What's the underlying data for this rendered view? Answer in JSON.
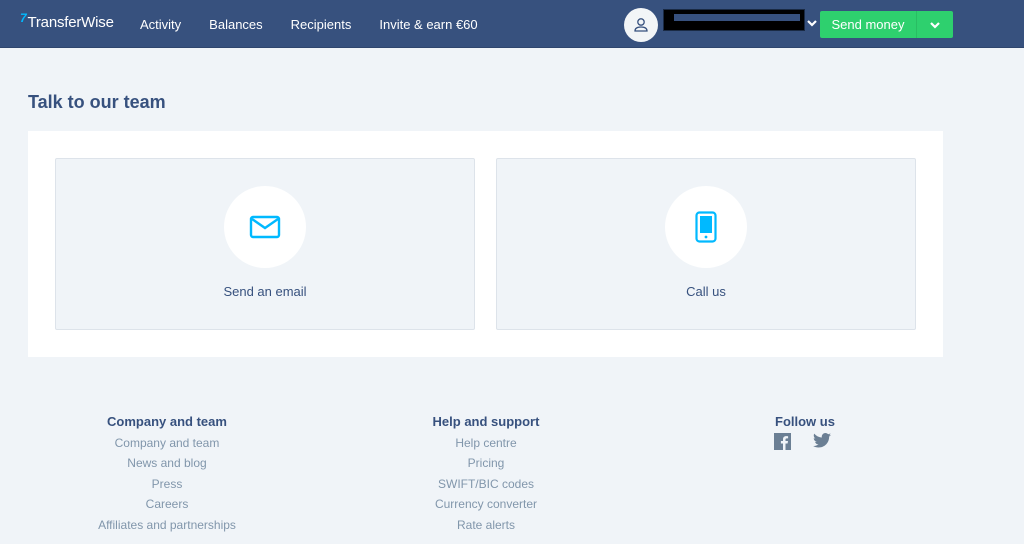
{
  "header": {
    "logo_mark": "7",
    "logo_text": "TransferWise",
    "nav": [
      {
        "label": "Activity"
      },
      {
        "label": "Balances"
      },
      {
        "label": "Recipients"
      },
      {
        "label": "Invite & earn €60"
      }
    ],
    "user_icon": "user-icon",
    "user_name_redacted": true,
    "send_money_label": "Send money",
    "colors": {
      "bar": "#37517e",
      "accent": "#2ed06e",
      "icon_blue": "#00b9ff"
    }
  },
  "main": {
    "title": "Talk to our team",
    "cards": [
      {
        "label": "Send an email",
        "icon": "envelope-icon"
      },
      {
        "label": "Call us",
        "icon": "phone-icon"
      }
    ]
  },
  "footer": {
    "columns": [
      {
        "heading": "Company and team",
        "links": [
          "Company and team",
          "News and blog",
          "Press",
          "Careers",
          "Affiliates and partnerships"
        ]
      },
      {
        "heading": "Help and support",
        "links": [
          "Help centre",
          "Pricing",
          "SWIFT/BIC codes",
          "Currency converter",
          "Rate alerts"
        ]
      }
    ],
    "follow": {
      "heading": "Follow us",
      "icons": [
        "facebook-icon",
        "twitter-icon"
      ]
    }
  }
}
